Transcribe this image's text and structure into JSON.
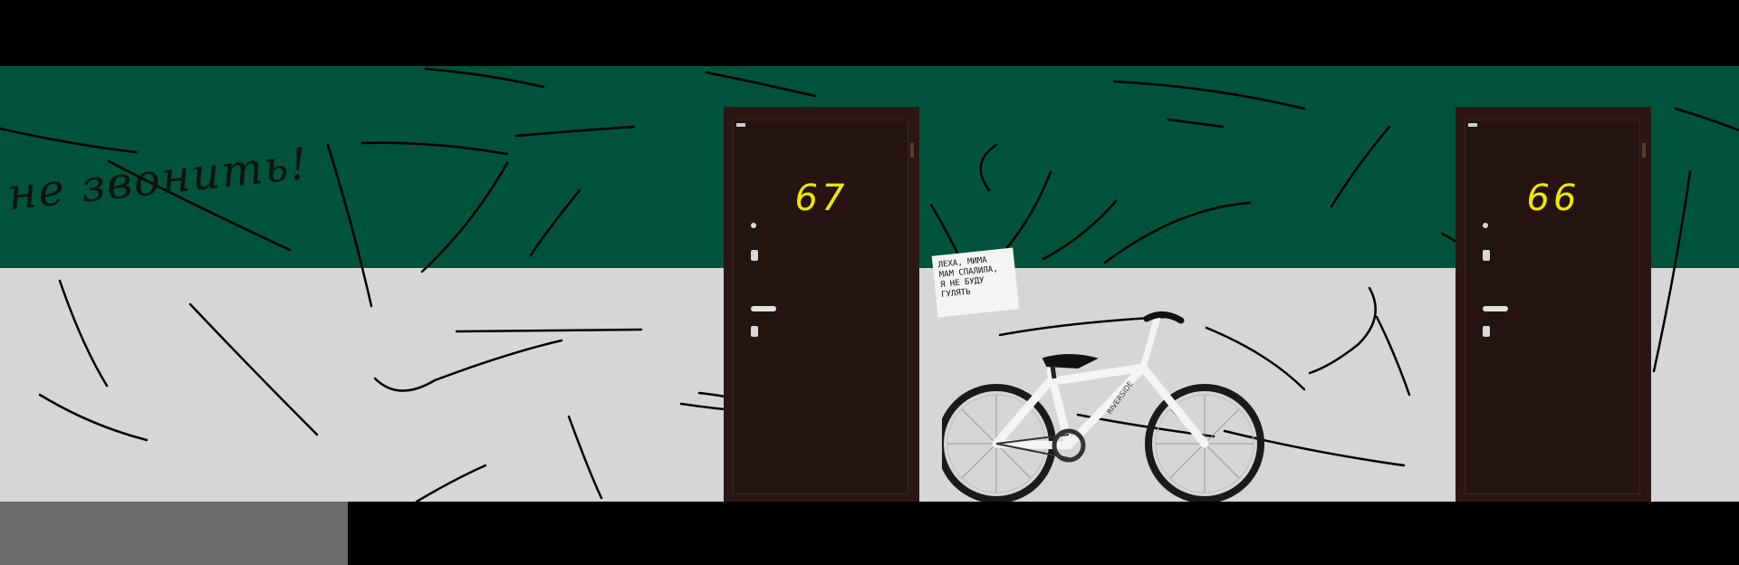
{
  "scene": {
    "colors": {
      "wall_top": "#01533b",
      "wall_bottom": "#d6d6d6",
      "floor_left": "#6c6a6b",
      "background": "#000000",
      "door": "#2a1713",
      "door_number": "#f2e600",
      "scribble": "#000000"
    }
  },
  "graffiti": {
    "text": "не звонить!"
  },
  "doors": [
    {
      "number": "67"
    },
    {
      "number": "66"
    }
  ],
  "note": {
    "text": "ЛЕХА, МИМА\nМАМ СПАЛИЛА,\nЯ НЕ БУДУ\nГУЛЯТЬ"
  },
  "bike": {
    "brand": "RIVERSIDE",
    "icon": "bicycle-icon"
  }
}
